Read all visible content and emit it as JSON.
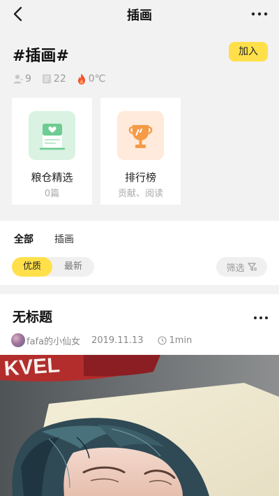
{
  "header": {
    "title": "插画"
  },
  "topic": {
    "name": "#插画#",
    "join_label": "加入",
    "stats": {
      "members": "9",
      "posts": "22",
      "heat": "0℃"
    }
  },
  "cards": [
    {
      "name": "粮仓精选",
      "sub": "0篇",
      "icon": "document-heart-icon",
      "bg": "#d9f2e1",
      "accent": "#6dcc92"
    },
    {
      "name": "排行榜",
      "sub": "贡献、阅读",
      "icon": "trophy-icon",
      "bg": "#ffeadb",
      "accent": "#f59a45"
    }
  ],
  "tabs": {
    "all": "全部",
    "illustration": "插画"
  },
  "sort": {
    "good": "优质",
    "latest": "最新"
  },
  "filter_label": "筛选",
  "post": {
    "title": "无标题",
    "author": "fafa的小仙女",
    "date": "2019.11.13",
    "read_time": "1min",
    "photo_caption": "KVEL"
  },
  "colors": {
    "accent_yellow": "#ffe04a",
    "background": "#f2f2f2"
  }
}
